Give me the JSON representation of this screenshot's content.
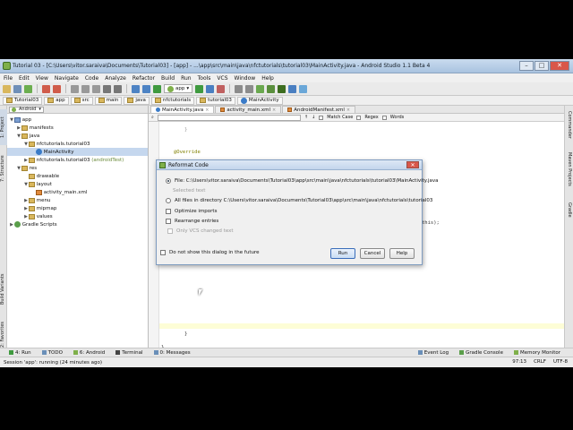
{
  "window": {
    "title": "Tutorial 03 - [C:\\Users\\vitor.saraiva\\Documents\\Tutorial03] - [app] - ...\\app\\src\\main\\java\\nfctutorials\\tutorial03\\MainActivity.java - Android Studio 1.1 Beta 4",
    "controls": {
      "minimize": "–",
      "maximize": "□",
      "close": "✕"
    }
  },
  "menubar": [
    "File",
    "Edit",
    "View",
    "Navigate",
    "Code",
    "Analyze",
    "Refactor",
    "Build",
    "Run",
    "Tools",
    "VCS",
    "Window",
    "Help"
  ],
  "toolbar": {
    "run_config": "app"
  },
  "breadcrumbs": [
    "Tutorial03",
    "app",
    "src",
    "main",
    "java",
    "nfctutorials",
    "tutorial03",
    "MainActivity"
  ],
  "project_panel": {
    "view_selector": "Android",
    "tree": [
      {
        "label": "app",
        "arrow": "▼",
        "icon": "folder"
      },
      {
        "label": "manifests",
        "arrow": "▶",
        "icon": "folder"
      },
      {
        "label": "java",
        "arrow": "▼",
        "icon": "folder"
      },
      {
        "label": "nfctutorials.tutorial03",
        "arrow": "▼",
        "icon": "folder"
      },
      {
        "label": "MainActivity",
        "arrow": "",
        "icon": "class",
        "selected": true
      },
      {
        "label": "nfctutorials.tutorial03",
        "suffix": "(androidTest)",
        "arrow": "▶",
        "icon": "folder"
      },
      {
        "label": "res",
        "arrow": "▼",
        "icon": "folder"
      },
      {
        "label": "drawable",
        "arrow": "",
        "icon": "folder"
      },
      {
        "label": "layout",
        "arrow": "▼",
        "icon": "folder"
      },
      {
        "label": "activity_main.xml",
        "arrow": "",
        "icon": "file"
      },
      {
        "label": "menu",
        "arrow": "▶",
        "icon": "folder"
      },
      {
        "label": "mipmap",
        "arrow": "▶",
        "icon": "folder"
      },
      {
        "label": "values",
        "arrow": "▶",
        "icon": "folder"
      },
      {
        "label": "Gradle Scripts",
        "arrow": "▶",
        "icon": "gradle"
      }
    ]
  },
  "left_tool_tabs": {
    "project": "1: Project",
    "structure": "7: Structure",
    "build_variants": "Build Variants",
    "favorites": "2: Favorites"
  },
  "right_tool_tabs": {
    "commander": "Commander",
    "maven": "Maven Projects",
    "gradle": "Gradle"
  },
  "editor_tabs": [
    {
      "label": "MainActivity.java",
      "active": true
    },
    {
      "label": "activity_main.xml",
      "active": false
    },
    {
      "label": "AndroidManifest.xml",
      "active": false
    }
  ],
  "find_bar": {
    "match_case": "Match Case",
    "regex": "Regex",
    "words": "Words"
  },
  "code_lines": {
    "l1": "}",
    "l2": "@Override",
    "l3": "this);",
    "l4": "}",
    "l5": "}"
  },
  "dialog": {
    "title": "Reformat Code",
    "close": "✕",
    "option_file": "File: C:\\Users\\vitor.saraiva\\Documents\\Tutorial03\\app\\src\\main\\java\\nfctutorials\\tutorial03\\MainActivity.java",
    "option_selected": "Selected text",
    "option_directory": "All files in directory C:\\Users\\vitor.saraiva\\Documents\\Tutorial03\\app\\src\\main\\java\\nfctutorials\\tutorial03",
    "optimize_imports": "Optimize imports",
    "rearrange_entries": "Rearrange entries",
    "vcs_changed": "Only VCS changed text",
    "dont_show": "Do not show this dialog in the future",
    "run": "Run",
    "cancel": "Cancel",
    "help": "Help"
  },
  "bottom_tabs": [
    "4: Run",
    "TODO",
    "6: Android",
    "Terminal",
    "0: Messages"
  ],
  "bottom_tabs_right": [
    "Event Log",
    "Gradle Console",
    "Memory Monitor"
  ],
  "status": {
    "message": "Session 'app': running (24 minutes ago)",
    "position": "97:13",
    "line_sep": "CRLF",
    "encoding": "UTF-8"
  }
}
